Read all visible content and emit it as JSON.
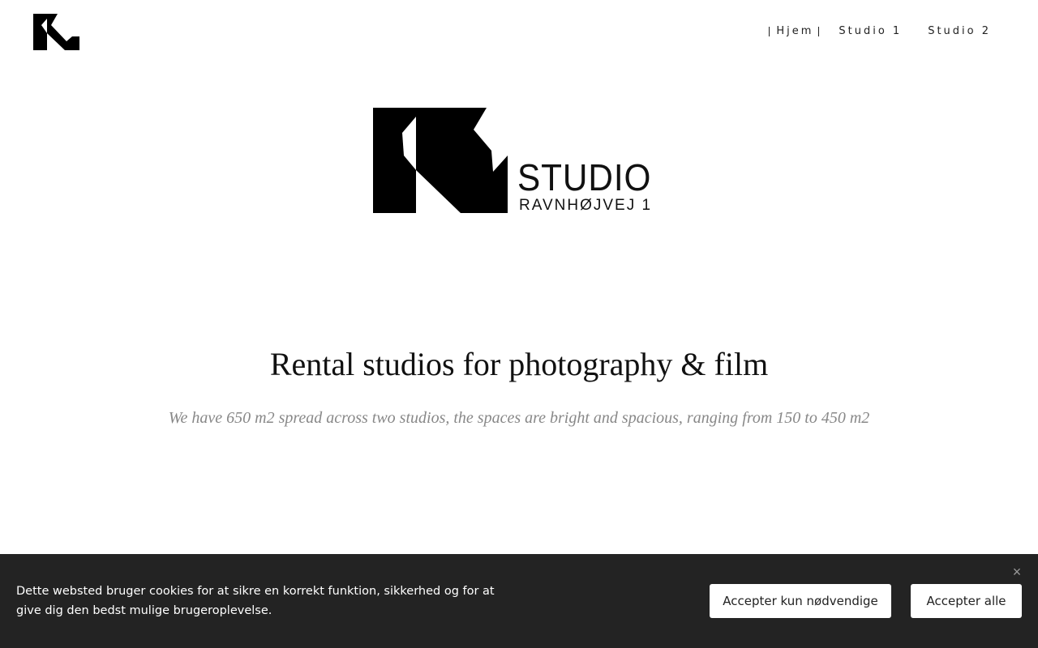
{
  "header": {
    "logo_icon": "k1-logo-icon",
    "nav": [
      {
        "label": "Hjem",
        "active": true
      },
      {
        "label": "Studio 1",
        "active": false
      },
      {
        "label": "Studio 2",
        "active": false
      }
    ]
  },
  "hero": {
    "logo_icon": "k1-studio-logo-icon",
    "studio_word": "STUDIO",
    "address": "RAVNHØJVEJ 1"
  },
  "main": {
    "headline": "Rental studios for photography & film",
    "subline": "We have 650 m2 spread across two studios, the spaces are bright and spacious, ranging from 150 to 450 m2"
  },
  "cookie_banner": {
    "text": "Dette websted bruger cookies for at sikre en korrekt funktion, sikkerhed og for at give dig den bedst mulige brugeroplevelse.",
    "close_icon": "close-icon",
    "accept_necessary_label": "Accepter kun nødvendige",
    "accept_all_label": "Accepter alle"
  },
  "colors": {
    "banner_bg": "#232323",
    "button_bg": "#ffffff",
    "subline_text": "#888888"
  }
}
